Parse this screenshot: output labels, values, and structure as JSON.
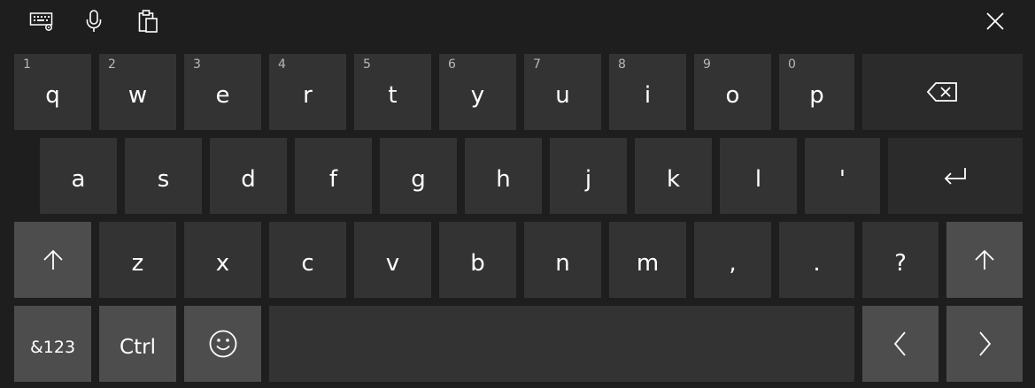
{
  "toolbar": {
    "items": [
      {
        "icon": "keyboard-settings-icon"
      },
      {
        "icon": "microphone-icon"
      },
      {
        "icon": "clipboard-icon"
      }
    ],
    "close_icon": "close-icon"
  },
  "keyboard": {
    "row1": [
      {
        "hint": "1",
        "label": "q"
      },
      {
        "hint": "2",
        "label": "w"
      },
      {
        "hint": "3",
        "label": "e"
      },
      {
        "hint": "4",
        "label": "r"
      },
      {
        "hint": "5",
        "label": "t"
      },
      {
        "hint": "6",
        "label": "y"
      },
      {
        "hint": "7",
        "label": "u"
      },
      {
        "hint": "8",
        "label": "i"
      },
      {
        "hint": "9",
        "label": "o"
      },
      {
        "hint": "0",
        "label": "p"
      }
    ],
    "row2": [
      "a",
      "s",
      "d",
      "f",
      "g",
      "h",
      "j",
      "k",
      "l",
      "'"
    ],
    "row3": [
      "z",
      "x",
      "c",
      "v",
      "b",
      "n",
      "m",
      ",",
      ".",
      "?"
    ],
    "row4": {
      "symbols_label": "&123",
      "ctrl_label": "Ctrl"
    },
    "icons": {
      "backspace": "backspace-icon",
      "enter": "enter-icon",
      "shift": "shift-icon",
      "emoji": "emoji-icon",
      "left": "arrow-left-icon",
      "right": "arrow-right-icon"
    }
  },
  "colors": {
    "background": "#1e1e1e",
    "key": "#333333",
    "key_special": "#2b2b2b",
    "key_shift": "#4d4d4d",
    "text": "#ffffff",
    "hint": "#b8b8b8"
  }
}
